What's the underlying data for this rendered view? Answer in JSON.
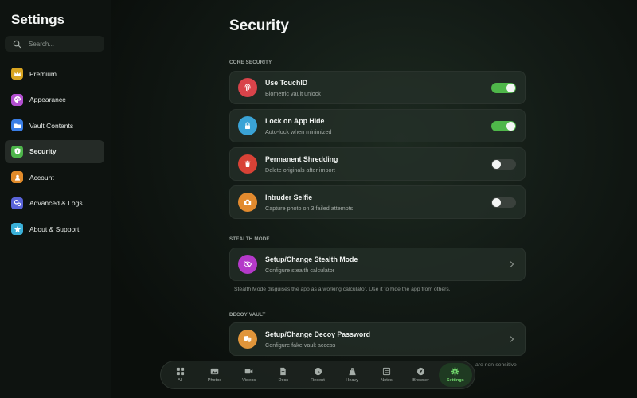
{
  "sidebar": {
    "title": "Settings",
    "search_placeholder": "Search...",
    "items": [
      {
        "label": "Premium",
        "icon": "crown-icon",
        "color": "#d9a521"
      },
      {
        "label": "Appearance",
        "icon": "palette-icon",
        "color": "#b34fd0"
      },
      {
        "label": "Vault Contents",
        "icon": "folder-icon",
        "color": "#3a7ee6"
      },
      {
        "label": "Security",
        "icon": "shield-icon",
        "color": "#4db54a",
        "active": true
      },
      {
        "label": "Account",
        "icon": "person-icon",
        "color": "#e08a2a"
      },
      {
        "label": "Advanced & Logs",
        "icon": "gears-icon",
        "color": "#5a64d8"
      },
      {
        "label": "About & Support",
        "icon": "star-icon",
        "color": "#3ab0d8"
      }
    ]
  },
  "main": {
    "title": "Security",
    "sections": {
      "core": {
        "header": "CORE SECURITY"
      },
      "stealth": {
        "header": "STEALTH MODE",
        "helper": "Stealth Mode disguises the app as a working calculator. Use it to hide the app from others."
      },
      "decoy": {
        "header": "DECOY VAULT",
        "helper_peek": "are non-sensitive"
      }
    },
    "rows": [
      {
        "title": "Use TouchID",
        "subtitle": "Biometric vault unlock",
        "icon": "fingerprint-icon",
        "color": "#d9434a",
        "toggle": true
      },
      {
        "title": "Lock on App Hide",
        "subtitle": "Auto-lock when minimized",
        "icon": "lock-icon",
        "color": "#3aa3d6",
        "toggle": true
      },
      {
        "title": "Permanent Shredding",
        "subtitle": "Delete originals after import",
        "icon": "trash-icon",
        "color": "#d84236",
        "toggle": false
      },
      {
        "title": "Intruder Selfie",
        "subtitle": "Capture photo on 3 failed attempts",
        "icon": "camera-icon",
        "color": "#e28a2e",
        "toggle": false
      },
      {
        "title": "Setup/Change Stealth Mode",
        "subtitle": "Configure stealth calculator",
        "icon": "eye-slash-icon",
        "color": "#b439c9"
      },
      {
        "title": "Setup/Change Decoy Password",
        "subtitle": "Configure fake vault access",
        "icon": "masks-icon",
        "color": "#e0953a"
      }
    ]
  },
  "tabbar": {
    "tabs": [
      {
        "label": "All",
        "icon": "grid-icon"
      },
      {
        "label": "Photos",
        "icon": "photo-icon"
      },
      {
        "label": "Videos",
        "icon": "video-icon"
      },
      {
        "label": "Docs",
        "icon": "doc-icon"
      },
      {
        "label": "Recent",
        "icon": "clock-icon"
      },
      {
        "label": "Heavy",
        "icon": "weight-icon"
      },
      {
        "label": "Notes",
        "icon": "note-icon"
      },
      {
        "label": "Browser",
        "icon": "compass-icon"
      },
      {
        "label": "Settings",
        "icon": "gear-icon",
        "active": true
      }
    ]
  }
}
